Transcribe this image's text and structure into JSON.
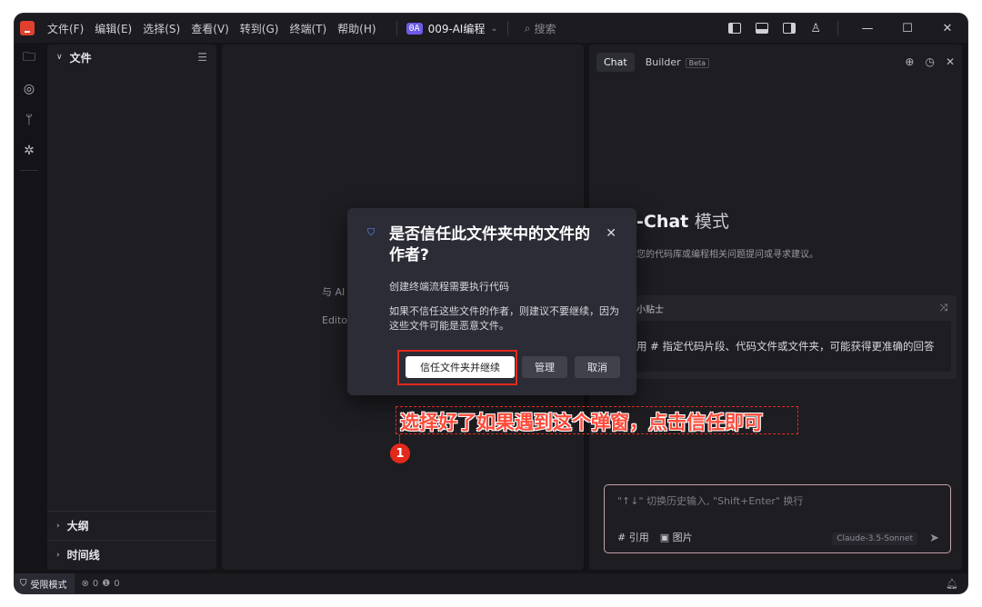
{
  "titlebar": {
    "menu": [
      "文件(F)",
      "编辑(E)",
      "选择(S)",
      "查看(V)",
      "转到(G)",
      "终端(T)",
      "帮助(H)"
    ],
    "project_badge": "0A",
    "project_name": "009-AI编程",
    "search_placeholder": "搜索"
  },
  "sidebar": {
    "explorer_title": "文件",
    "outline_title": "大纲",
    "timeline_title": "时间线"
  },
  "editor": {
    "hint1": "与 AI",
    "hint2": "Edito"
  },
  "chat": {
    "tab_chat": "Chat",
    "tab_builder": "Builder",
    "beta_badge": "Beta",
    "heading_bold": "-Chat",
    "heading_thin": "模式",
    "subtitle": "您的代码库或编程相关问题提问或寻求建议。",
    "tip_title": "小贴士",
    "tip_body": "用 # 指定代码片段、代码文件或文件夹，可能获得更准确的回答",
    "input_placeholder": "\"↑↓\" 切换历史输入, \"Shift+Enter\" 换行",
    "ref_label": "# 引用",
    "image_label": "图片",
    "model_label": "Claude-3.5-Sonnet"
  },
  "statusbar": {
    "restricted_mode": "受限模式",
    "errors": "0",
    "warnings": "0"
  },
  "dialog": {
    "title": "是否信任此文件夹中的文件的作者?",
    "message1": "创建终端流程需要执行代码",
    "message2": "如果不信任这些文件的作者，则建议不要继续，因为这些文件可能是恶意文件。",
    "trust_button": "信任文件夹并继续",
    "manage_button": "管理",
    "cancel_button": "取消"
  },
  "annotation": {
    "text": "选择好了如果遇到这个弹窗，点击信任即可",
    "badge": "1"
  },
  "colors": {
    "accent": "#6c5ce7",
    "highlight_red": "#e2291b",
    "dialog_bg": "#2b2c35"
  }
}
